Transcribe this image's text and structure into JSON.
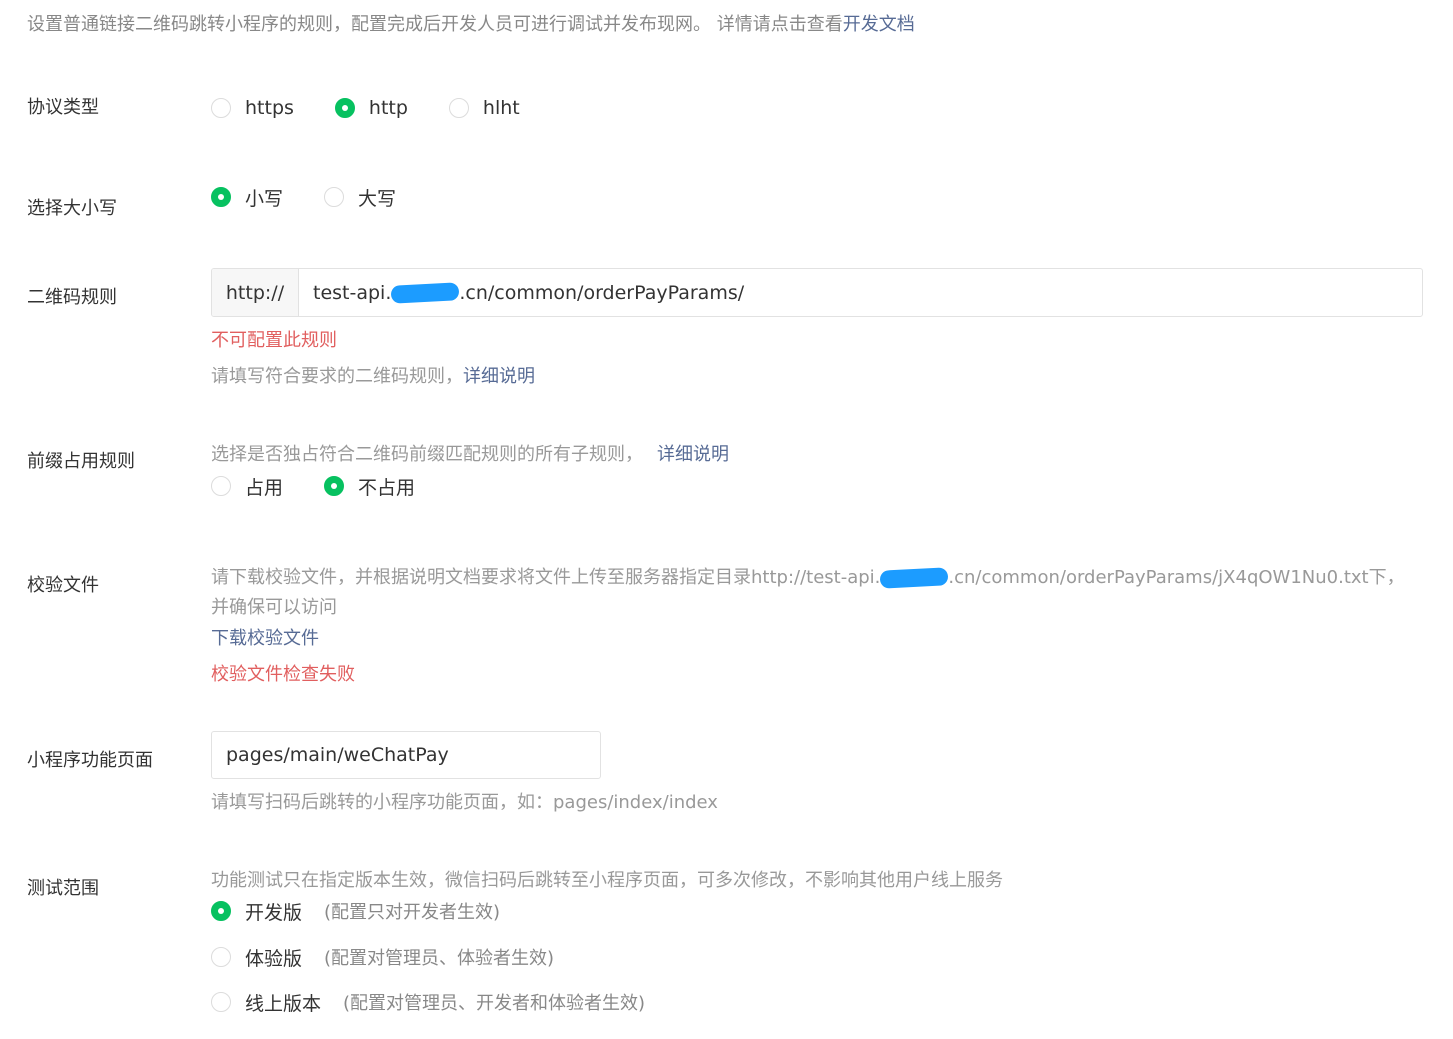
{
  "intro": {
    "text": "设置普通链接二维码跳转小程序的规则，配置完成后开发人员可进行调试并发布现网。 详情请点击查看",
    "link": "开发文档"
  },
  "protocol": {
    "label": "协议类型",
    "options": [
      "https",
      "http",
      "hlht"
    ],
    "selected": "http"
  },
  "case": {
    "label": "选择大小写",
    "options": [
      "小写",
      "大写"
    ],
    "selected": "小写"
  },
  "qr_rule": {
    "label": "二维码规则",
    "prefix": "http://",
    "value_before": "test-api.",
    "value_after": ".cn/common/orderPayParams/",
    "error": "不可配置此规则",
    "help": "请填写符合要求的二维码规则，",
    "help_link": "详细说明"
  },
  "prefix_rule": {
    "label": "前缀占用规则",
    "help": "选择是否独占符合二维码前缀匹配规则的所有子规则，",
    "help_link": "详细说明",
    "options": [
      "占用",
      "不占用"
    ],
    "selected": "不占用"
  },
  "verify_file": {
    "label": "校验文件",
    "desc_before": "请下载校验文件，并根据说明文档要求将文件上传至服务器指定目录http://test-api.",
    "desc_after": ".cn/common/orderPayParams/jX4qOW1Nu0.txt下，并确保可以访问",
    "download_link": "下载校验文件",
    "error": "校验文件检查失败"
  },
  "mini_page": {
    "label": "小程序功能页面",
    "value": "pages/main/weChatPay",
    "help": "请填写扫码后跳转的小程序功能页面，如：pages/index/index"
  },
  "test_scope": {
    "label": "测试范围",
    "help": "功能测试只在指定版本生效，微信扫码后跳转至小程序页面，可多次修改，不影响其他用户线上服务",
    "options": [
      {
        "label": "开发版",
        "note": "(配置只对开发者生效)"
      },
      {
        "label": "体验版",
        "note": "(配置对管理员、体验者生效)"
      },
      {
        "label": "线上版本",
        "note": "(配置对管理员、开发者和体验者生效)"
      }
    ],
    "selected": "开发版"
  },
  "colors": {
    "accent": "#07c160",
    "link": "#576b95",
    "error": "#e15f5f",
    "redaction": "#1c9cff"
  }
}
